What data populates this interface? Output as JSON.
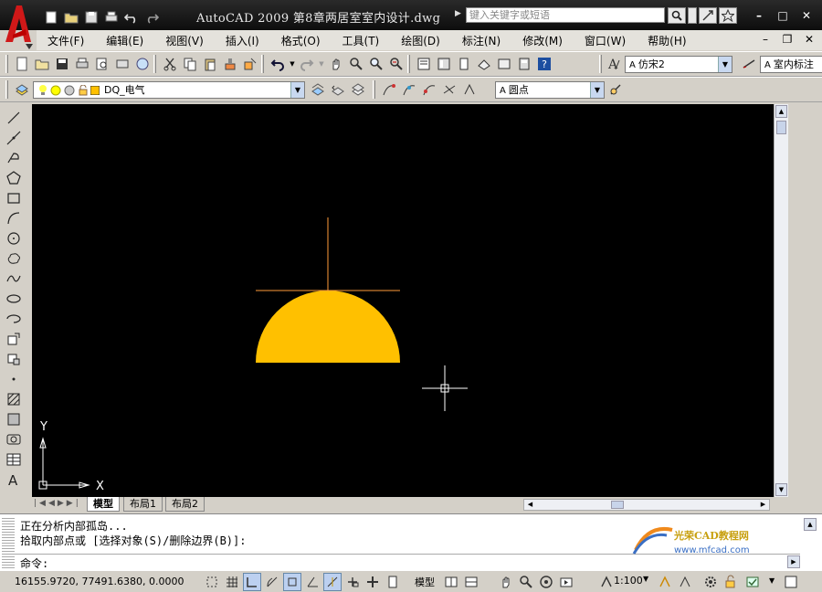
{
  "window": {
    "title": "AutoCAD 2009  第8章两居室室内设计.dwg",
    "search_placeholder": "键入关键字或短语",
    "minimize_label": "–",
    "maximize_label": "□",
    "close_label": "✕"
  },
  "menu": {
    "items": [
      "文件(F)",
      "编辑(E)",
      "视图(V)",
      "插入(I)",
      "格式(O)",
      "工具(T)",
      "绘图(D)",
      "标注(N)",
      "修改(M)",
      "窗口(W)",
      "帮助(H)"
    ]
  },
  "toolbar": {
    "text_style": "仿宋2",
    "dim_style": "室内标注",
    "layer": "DQ_电气",
    "visual_style": "圆点"
  },
  "drawing": {
    "fill_color": "#ffc000",
    "line_color": "#ff9c3a",
    "ucs_x_label": "X",
    "ucs_y_label": "Y"
  },
  "tabs": [
    "模型",
    "布局1",
    "布局2"
  ],
  "command": {
    "history_1": "正在分析内部孤岛...",
    "history_2": "拾取内部点或 [选择对象(S)/删除边界(B)]:",
    "prompt": "命令:"
  },
  "watermark": {
    "title": "光荣CAD教程网",
    "url": "www.mfcad.com"
  },
  "status": {
    "coordinates": "16155.9720, 77491.6380, 0.0000",
    "model_label": "模型",
    "scale": "1:100"
  }
}
